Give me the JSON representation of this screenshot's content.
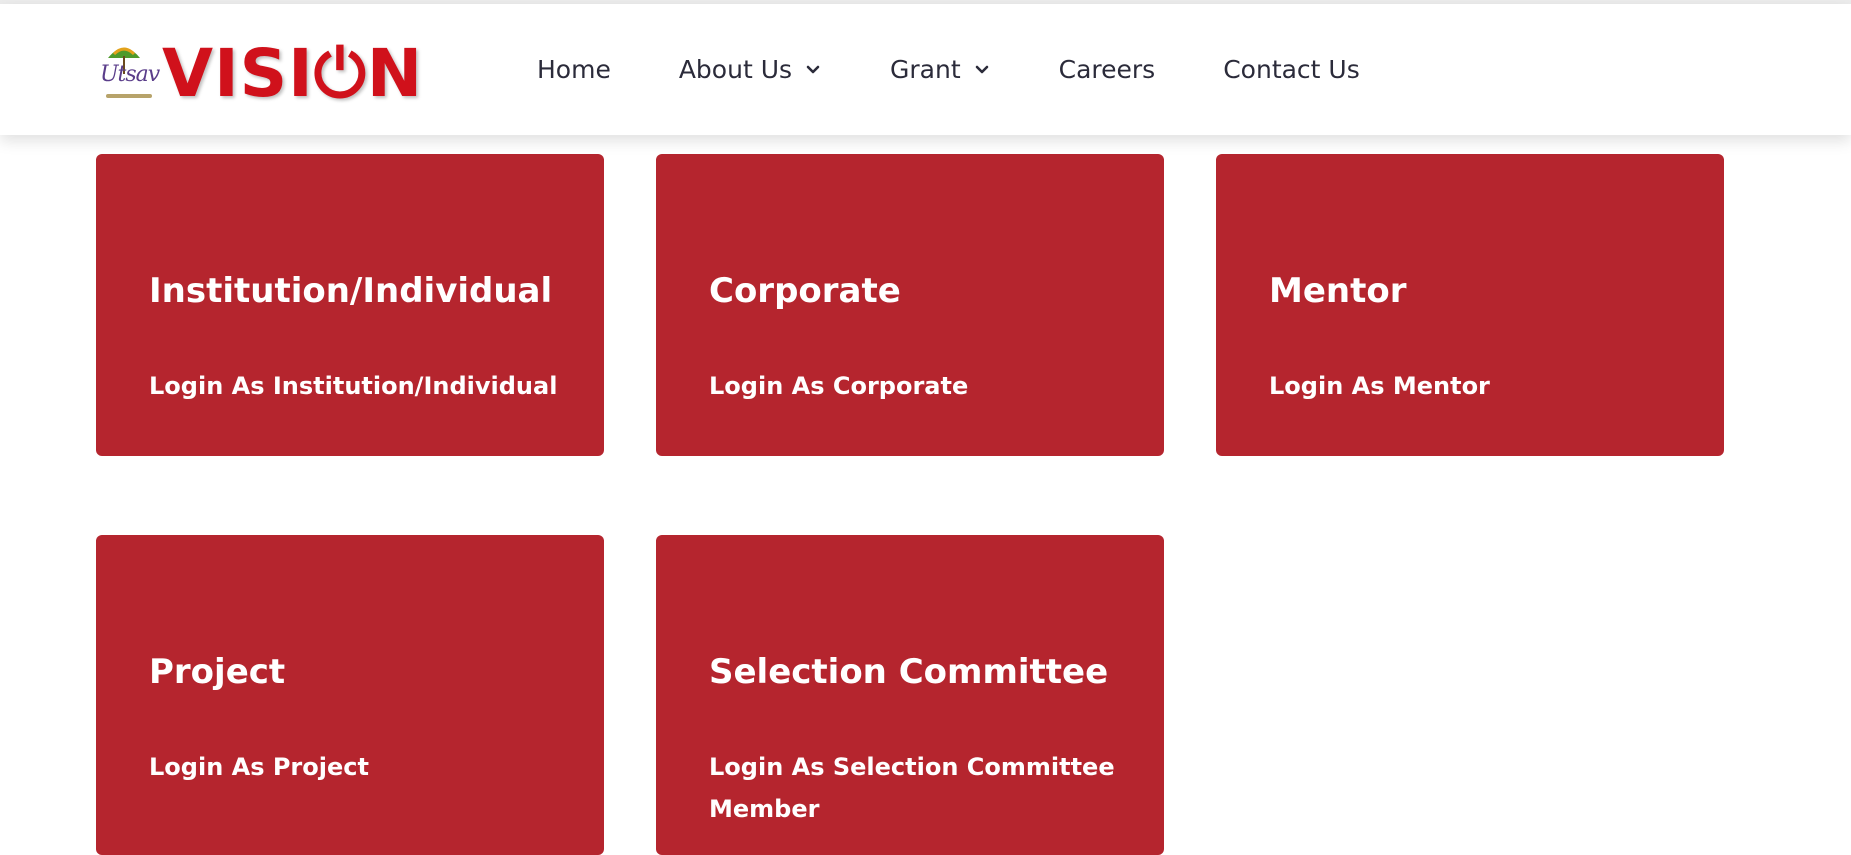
{
  "brand": {
    "small_text": "Utsav",
    "big_text": "VISI⏻N"
  },
  "nav": {
    "items": [
      {
        "label": "Home",
        "dropdown": false
      },
      {
        "label": "About Us",
        "dropdown": true
      },
      {
        "label": "Grant",
        "dropdown": true
      },
      {
        "label": "Careers",
        "dropdown": false
      },
      {
        "label": "Contact Us",
        "dropdown": false
      }
    ]
  },
  "cards": [
    {
      "title": "Institution/Individual",
      "link": "Login As Institution/Individual"
    },
    {
      "title": "Corporate",
      "link": "Login As Corporate"
    },
    {
      "title": "Mentor",
      "link": "Login As Mentor"
    },
    {
      "title": "Project",
      "link": "Login As Project"
    },
    {
      "title": "Selection Committee",
      "link": "Login As Selection Committee Member"
    }
  ],
  "colors": {
    "card_bg": "#b5252e",
    "brand_red": "#d0111b",
    "nav_text": "#2b2b3a"
  }
}
